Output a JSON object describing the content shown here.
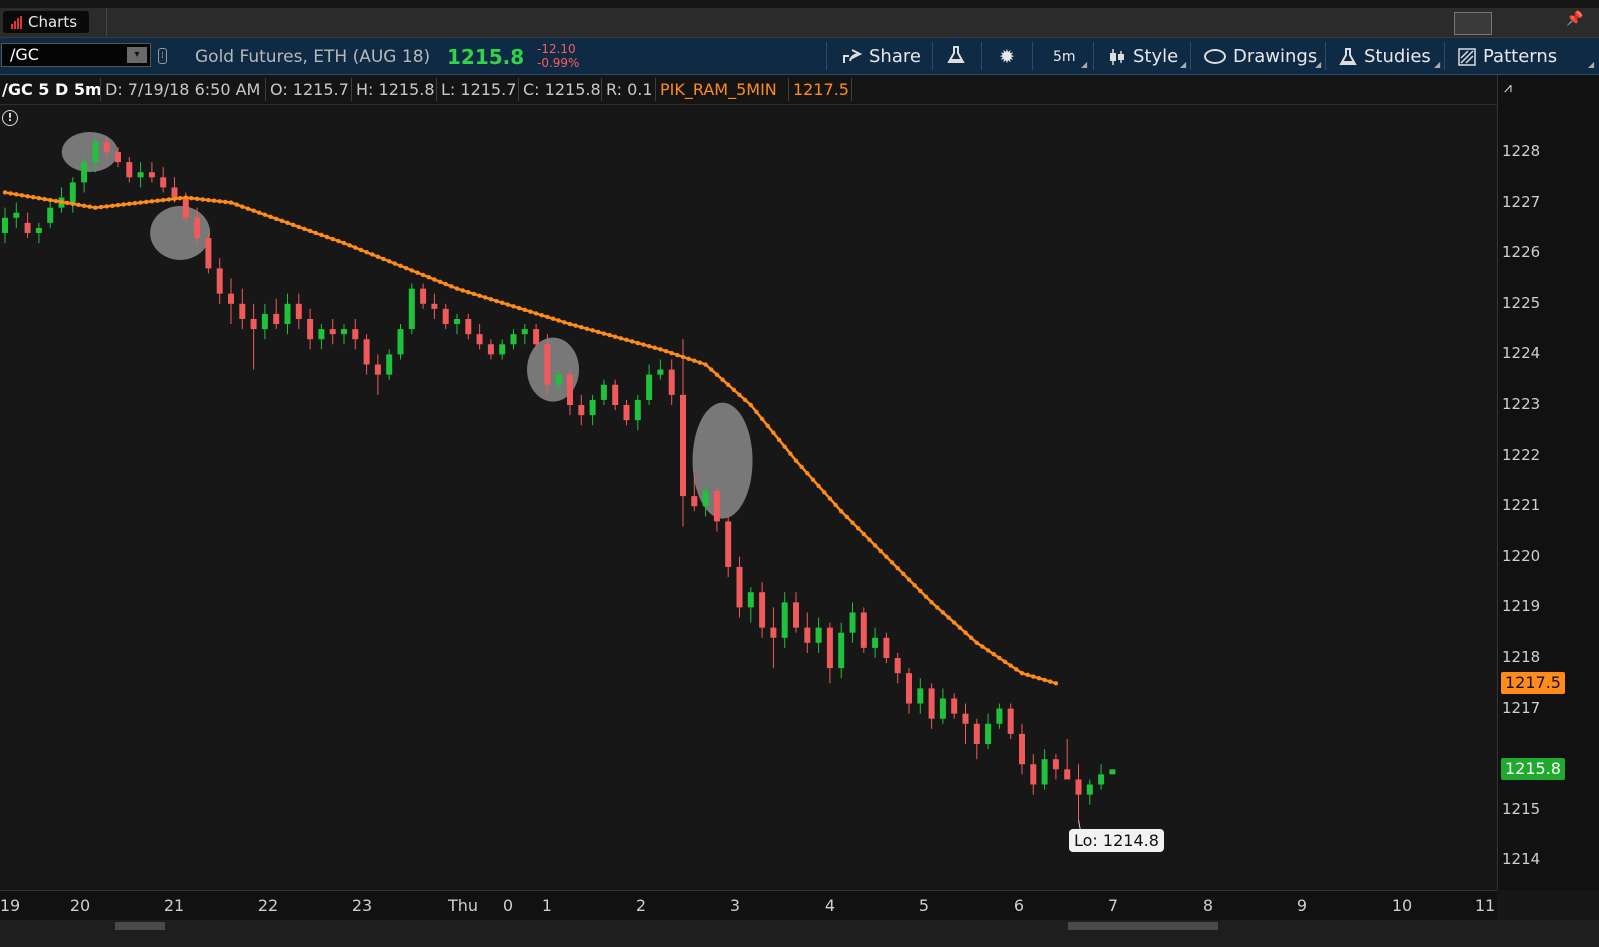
{
  "title_bar": {
    "tab_label": "Charts"
  },
  "toolbar": {
    "symbol": "/GC",
    "instrument": "Gold Futures, ETH (AUG 18)",
    "last_price": "1215.8",
    "change": "-12.10",
    "change_pct": "-0.99%",
    "share": "Share",
    "aggregation": "5m",
    "style": "Style",
    "drawings": "Drawings",
    "studies": "Studies",
    "patterns": "Patterns"
  },
  "info_bar": {
    "chart_title": "/GC 5 D 5m",
    "date": "D: 7/19/18 6:50 AM",
    "open": "O: 1215.7",
    "high": "H: 1215.8",
    "low": "L: 1215.7",
    "close": "C: 1215.8",
    "range": "R: 0.1",
    "study_name": "PIK_RAM_5MIN",
    "study_value": "1217.5"
  },
  "price_axis": {
    "ticks": [
      "1228",
      "1227",
      "1226",
      "1225",
      "1224",
      "1223",
      "1222",
      "1221",
      "1220",
      "1219",
      "1218",
      "1217",
      "1215",
      "1214"
    ],
    "study_tag": "1217.5",
    "price_tag": "1215.8"
  },
  "time_axis": {
    "ticks": [
      "19",
      "20",
      "21",
      "22",
      "23",
      "Thu",
      "0",
      "1",
      "2",
      "3",
      "4",
      "5",
      "6",
      "7",
      "8",
      "9",
      "10",
      "11"
    ]
  },
  "low_label": "Lo: 1214.8",
  "colors": {
    "up": "#1fc23a",
    "down": "#f05a5a",
    "study": "#ff8c1a",
    "background": "#171717"
  },
  "chart_data": {
    "type": "candlestick",
    "symbol": "/GC",
    "aggregation": "5m",
    "y_range": [
      1213.4,
      1229.1
    ],
    "candles": [
      [
        1226.4,
        1226.9,
        1226.2,
        1226.7
      ],
      [
        1226.7,
        1227.0,
        1226.5,
        1226.8
      ],
      [
        1226.6,
        1226.8,
        1226.3,
        1226.4
      ],
      [
        1226.4,
        1226.6,
        1226.2,
        1226.5
      ],
      [
        1226.6,
        1227.0,
        1226.5,
        1226.9
      ],
      [
        1226.9,
        1227.3,
        1226.8,
        1227.1
      ],
      [
        1227.0,
        1227.5,
        1226.8,
        1227.4
      ],
      [
        1227.4,
        1227.9,
        1227.2,
        1227.8
      ],
      [
        1227.8,
        1228.3,
        1227.6,
        1228.2
      ],
      [
        1228.2,
        1228.3,
        1227.9,
        1228.0
      ],
      [
        1228.0,
        1228.1,
        1227.7,
        1227.8
      ],
      [
        1227.8,
        1227.9,
        1227.4,
        1227.5
      ],
      [
        1227.5,
        1227.8,
        1227.3,
        1227.6
      ],
      [
        1227.6,
        1227.8,
        1227.4,
        1227.5
      ],
      [
        1227.5,
        1227.7,
        1227.2,
        1227.3
      ],
      [
        1227.3,
        1227.5,
        1227.0,
        1227.1
      ],
      [
        1227.1,
        1227.2,
        1226.6,
        1226.7
      ],
      [
        1226.7,
        1226.9,
        1226.2,
        1226.3
      ],
      [
        1226.3,
        1226.4,
        1225.6,
        1225.7
      ],
      [
        1225.7,
        1225.9,
        1225.0,
        1225.2
      ],
      [
        1225.2,
        1225.5,
        1224.6,
        1225.0
      ],
      [
        1225.0,
        1225.3,
        1224.5,
        1224.7
      ],
      [
        1224.7,
        1225.0,
        1223.7,
        1224.5
      ],
      [
        1224.5,
        1225.0,
        1224.3,
        1224.8
      ],
      [
        1224.8,
        1225.1,
        1224.5,
        1224.6
      ],
      [
        1224.6,
        1225.2,
        1224.4,
        1225.0
      ],
      [
        1225.0,
        1225.2,
        1224.5,
        1224.7
      ],
      [
        1224.7,
        1224.9,
        1224.1,
        1224.3
      ],
      [
        1224.3,
        1224.6,
        1224.1,
        1224.5
      ],
      [
        1224.5,
        1224.7,
        1224.2,
        1224.4
      ],
      [
        1224.4,
        1224.6,
        1224.2,
        1224.5
      ],
      [
        1224.5,
        1224.7,
        1224.1,
        1224.3
      ],
      [
        1224.3,
        1224.4,
        1223.6,
        1223.8
      ],
      [
        1223.8,
        1224.0,
        1223.2,
        1223.6
      ],
      [
        1223.6,
        1224.1,
        1223.5,
        1224.0
      ],
      [
        1224.0,
        1224.6,
        1223.9,
        1224.5
      ],
      [
        1224.5,
        1225.4,
        1224.4,
        1225.3
      ],
      [
        1225.3,
        1225.4,
        1224.9,
        1225.0
      ],
      [
        1225.0,
        1225.2,
        1224.7,
        1224.9
      ],
      [
        1224.9,
        1225.0,
        1224.5,
        1224.6
      ],
      [
        1224.6,
        1224.8,
        1224.4,
        1224.7
      ],
      [
        1224.7,
        1224.8,
        1224.3,
        1224.4
      ],
      [
        1224.4,
        1224.6,
        1224.1,
        1224.2
      ],
      [
        1224.2,
        1224.3,
        1223.9,
        1224.0
      ],
      [
        1224.0,
        1224.3,
        1223.9,
        1224.2
      ],
      [
        1224.2,
        1224.5,
        1224.1,
        1224.4
      ],
      [
        1224.4,
        1224.6,
        1224.2,
        1224.5
      ],
      [
        1224.5,
        1224.6,
        1224.1,
        1224.2
      ],
      [
        1224.2,
        1224.4,
        1223.2,
        1223.4
      ],
      [
        1223.4,
        1223.7,
        1223.3,
        1223.6
      ],
      [
        1223.6,
        1223.7,
        1222.8,
        1223.0
      ],
      [
        1223.0,
        1223.2,
        1222.6,
        1222.8
      ],
      [
        1222.8,
        1223.2,
        1222.6,
        1223.1
      ],
      [
        1223.1,
        1223.5,
        1223.0,
        1223.4
      ],
      [
        1223.4,
        1223.5,
        1222.9,
        1223.0
      ],
      [
        1223.0,
        1223.1,
        1222.6,
        1222.7
      ],
      [
        1222.7,
        1223.2,
        1222.5,
        1223.1
      ],
      [
        1223.1,
        1223.8,
        1223.0,
        1223.6
      ],
      [
        1223.6,
        1223.9,
        1223.5,
        1223.7
      ],
      [
        1223.7,
        1223.9,
        1223.0,
        1223.2
      ],
      [
        1223.2,
        1224.3,
        1220.6,
        1221.2
      ],
      [
        1221.2,
        1221.6,
        1220.9,
        1221.0
      ],
      [
        1221.0,
        1221.4,
        1220.8,
        1221.3
      ],
      [
        1221.3,
        1221.4,
        1220.5,
        1220.7
      ],
      [
        1220.7,
        1220.8,
        1219.6,
        1219.8
      ],
      [
        1219.8,
        1220.0,
        1218.8,
        1219.0
      ],
      [
        1219.0,
        1219.4,
        1218.7,
        1219.3
      ],
      [
        1219.3,
        1219.5,
        1218.4,
        1218.6
      ],
      [
        1218.6,
        1219.0,
        1217.8,
        1218.4
      ],
      [
        1218.4,
        1219.3,
        1218.2,
        1219.1
      ],
      [
        1219.1,
        1219.3,
        1218.5,
        1218.6
      ],
      [
        1218.6,
        1218.9,
        1218.1,
        1218.3
      ],
      [
        1218.3,
        1218.8,
        1218.1,
        1218.6
      ],
      [
        1218.6,
        1218.7,
        1217.5,
        1217.8
      ],
      [
        1217.8,
        1218.7,
        1217.6,
        1218.5
      ],
      [
        1218.5,
        1219.1,
        1218.3,
        1218.9
      ],
      [
        1218.9,
        1219.0,
        1218.1,
        1218.2
      ],
      [
        1218.2,
        1218.6,
        1218.0,
        1218.4
      ],
      [
        1218.4,
        1218.5,
        1217.9,
        1218.0
      ],
      [
        1218.0,
        1218.1,
        1217.5,
        1217.7
      ],
      [
        1217.7,
        1217.8,
        1216.9,
        1217.1
      ],
      [
        1217.1,
        1217.6,
        1216.9,
        1217.4
      ],
      [
        1217.4,
        1217.5,
        1216.6,
        1216.8
      ],
      [
        1216.8,
        1217.4,
        1216.7,
        1217.2
      ],
      [
        1217.2,
        1217.3,
        1216.8,
        1216.9
      ],
      [
        1216.9,
        1217.1,
        1216.3,
        1216.7
      ],
      [
        1216.7,
        1216.8,
        1216.0,
        1216.3
      ],
      [
        1216.3,
        1216.9,
        1216.2,
        1216.7
      ],
      [
        1216.7,
        1217.1,
        1216.6,
        1217.0
      ],
      [
        1217.0,
        1217.1,
        1216.4,
        1216.5
      ],
      [
        1216.5,
        1216.7,
        1215.7,
        1215.9
      ],
      [
        1215.9,
        1216.1,
        1215.3,
        1215.5
      ],
      [
        1215.5,
        1216.2,
        1215.4,
        1216.0
      ],
      [
        1216.0,
        1216.1,
        1215.6,
        1215.8
      ],
      [
        1215.8,
        1216.4,
        1215.6,
        1215.6
      ],
      [
        1215.6,
        1215.9,
        1214.8,
        1215.3
      ],
      [
        1215.3,
        1215.6,
        1215.1,
        1215.5
      ],
      [
        1215.5,
        1215.9,
        1215.4,
        1215.7
      ],
      [
        1215.7,
        1215.8,
        1215.7,
        1215.8
      ]
    ],
    "study_line": {
      "name": "PIK_RAM_5MIN",
      "points": [
        [
          0,
          1227.2
        ],
        [
          8,
          1226.9
        ],
        [
          16,
          1227.1
        ],
        [
          20,
          1227.0
        ],
        [
          30,
          1226.2
        ],
        [
          40,
          1225.3
        ],
        [
          50,
          1224.6
        ],
        [
          58,
          1224.1
        ],
        [
          62,
          1223.8
        ],
        [
          66,
          1223.0
        ],
        [
          70,
          1221.9
        ],
        [
          74,
          1220.9
        ],
        [
          78,
          1220.0
        ],
        [
          82,
          1219.1
        ],
        [
          86,
          1218.3
        ],
        [
          90,
          1217.7
        ],
        [
          93,
          1217.5
        ]
      ]
    },
    "highlights": [
      {
        "center_index": 7.5,
        "price": 1228.0
      },
      {
        "center_index": 15.5,
        "price": 1226.4
      },
      {
        "center_index": 48.5,
        "price": 1223.7
      },
      {
        "center_index": 63.5,
        "price": 1221.9
      }
    ],
    "low": 1214.8
  }
}
